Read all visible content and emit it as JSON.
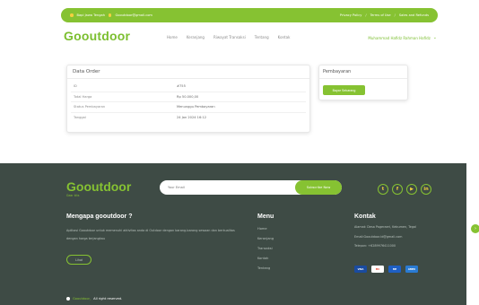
{
  "topbar": {
    "location": "Bapi Jawa Tengah",
    "email": "Gooutdoor@gmail.com",
    "links": [
      "Privacy Policy",
      "Terms of Use",
      "Sales and Refunds"
    ],
    "separator": "/"
  },
  "header": {
    "logo": "Gooutdoor",
    "nav": [
      "Home",
      "Keranjang",
      "Riwayat Transaksi",
      "Tentang",
      "Kontak"
    ],
    "user": "Muhammad Hafidz Rahman Hafidz",
    "user_chevron": "⌄"
  },
  "order": {
    "title": "Data Order",
    "rows": [
      {
        "label": "ID",
        "value": "#755"
      },
      {
        "label": "Total Harga",
        "value": "Rp 50.000,00"
      },
      {
        "label": "Status Pembayaran",
        "value": "Menunggu Pembayaran"
      },
      {
        "label": "Tanggal",
        "value": "24 Jan 2024 16:12"
      }
    ]
  },
  "payment": {
    "title": "Pembayaran",
    "button": "Bayar Sekarang"
  },
  "footer": {
    "logo": "Gooutdoor",
    "tagline": "Gear kits",
    "subscribe_placeholder": "Your Email",
    "subscribe_button": "Subscribe Now",
    "socials": [
      {
        "icon": "twitter-icon",
        "glyph": "t"
      },
      {
        "icon": "facebook-icon",
        "glyph": "f"
      },
      {
        "icon": "youtube-icon",
        "glyph": "▶"
      },
      {
        "icon": "linkedin-icon",
        "glyph": "in"
      }
    ],
    "about_title": "Mengapa gooutdoor ?",
    "about_text": "Aplikasi Gooutdoor untuk memenuhi aktivitas anda di Outdoor dengan barang-barang sewaan dan berkualitas dengan harga terjangkau",
    "about_button": "Lihat",
    "menu_title": "Menu",
    "menu_items": [
      "Home",
      "Keranjang",
      "Transaksi",
      "Kontak",
      "Tentang"
    ],
    "contact_title": "Kontak",
    "contact_items": [
      "Alamat: Desa Pageraeri, Kebumen, Tegal",
      "Email:Gooutdoor.id@gmail.com",
      "Telepon: +6289976411000"
    ],
    "payment_cards": [
      {
        "name": "VISA",
        "bg": "#1a4ba0",
        "fg": "#ffffff"
      },
      {
        "name": "MC",
        "bg": "#ffffff",
        "fg": "#e8432e"
      },
      {
        "name": "ME",
        "bg": "#1e5fc4",
        "fg": "#ffffff"
      },
      {
        "name": "AMEX",
        "bg": "#2a7bd3",
        "fg": "#ffffff"
      }
    ],
    "copyright_brand": "Gooutdoor,",
    "copyright_text": "All right reserved."
  },
  "colors": {
    "accent": "#86c232",
    "footer_bg": "#3e4b45"
  }
}
